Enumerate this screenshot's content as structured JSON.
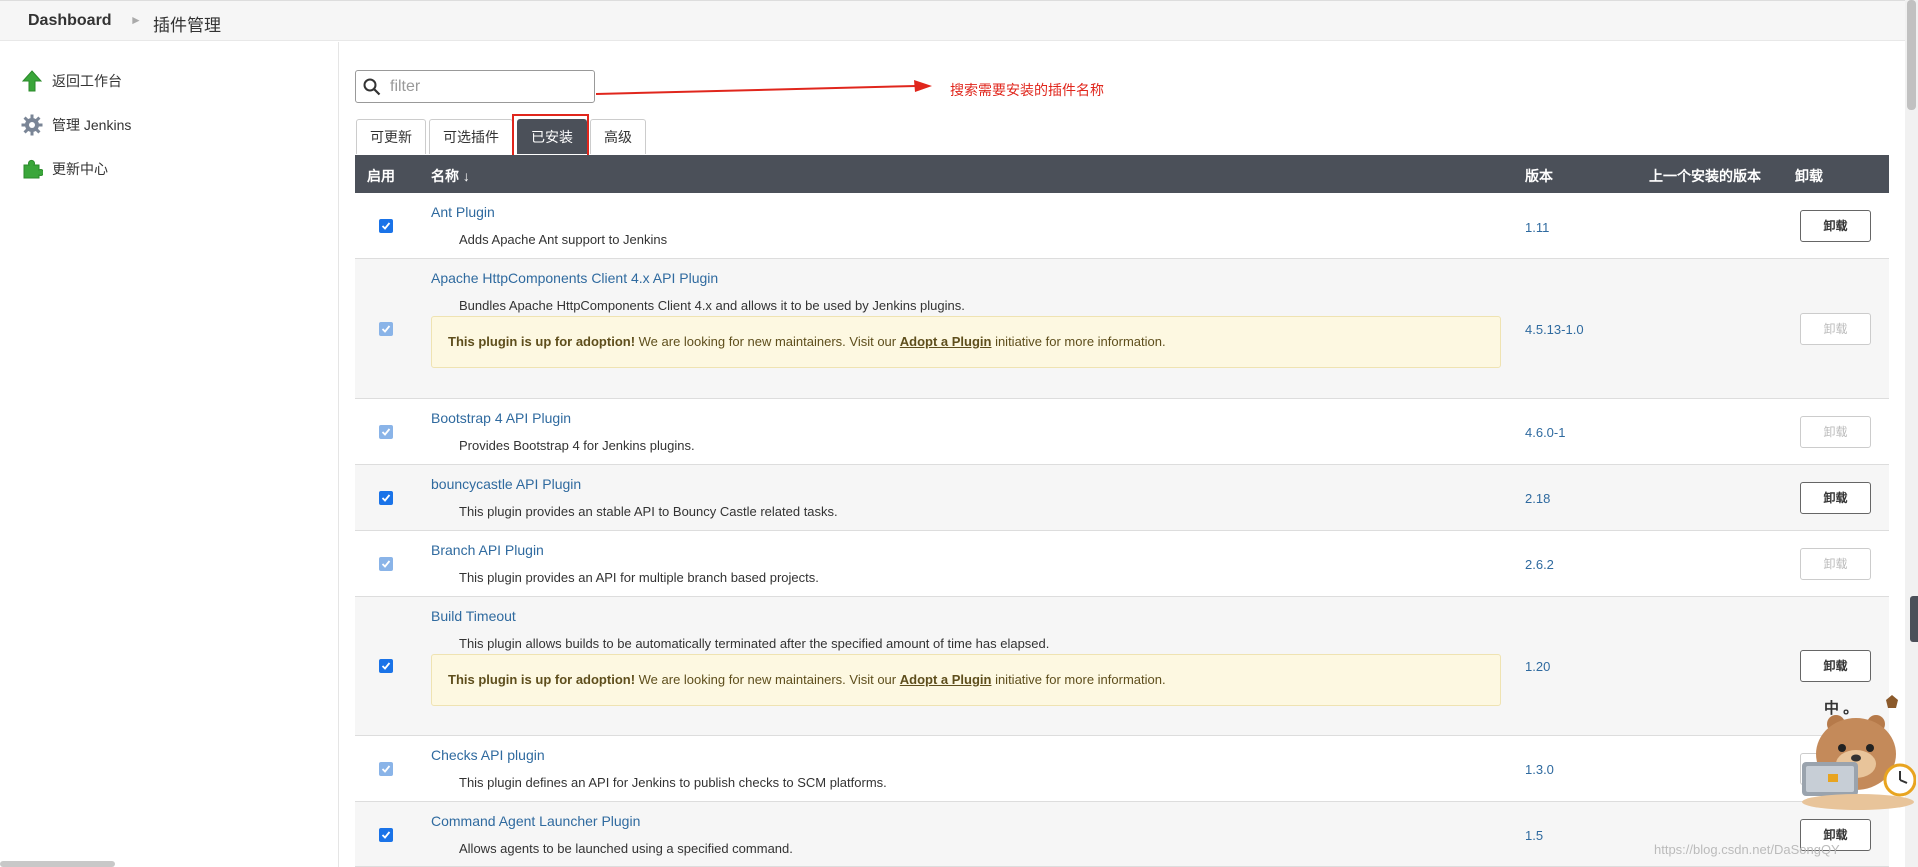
{
  "breadcrumb": {
    "root": "Dashboard",
    "current": "插件管理"
  },
  "sidebar": {
    "items": [
      {
        "label": "返回工作台",
        "icon": "up-arrow-icon"
      },
      {
        "label": "管理 Jenkins",
        "icon": "gear-icon"
      },
      {
        "label": "更新中心",
        "icon": "puzzle-icon"
      }
    ]
  },
  "search": {
    "placeholder": "filter",
    "value": ""
  },
  "annotation": {
    "text": "搜索需要安装的插件名称"
  },
  "tabs": [
    {
      "label": "可更新",
      "active": false
    },
    {
      "label": "可选插件",
      "active": false
    },
    {
      "label": "已安装",
      "active": true
    },
    {
      "label": "高级",
      "active": false
    }
  ],
  "table": {
    "headers": {
      "enabled": "启用",
      "name": "名称 ↓",
      "version": "版本",
      "previous": "上一个安装的版本",
      "uninstall": "卸载"
    },
    "rows": [
      {
        "name": "Ant Plugin",
        "desc": "Adds Apache Ant support to Jenkins",
        "version": "1.11",
        "checked": true,
        "disabled": false,
        "uninstall": "卸载",
        "uninstall_enabled": true
      },
      {
        "name": "Apache HttpComponents Client 4.x API Plugin",
        "desc": "Bundles Apache HttpComponents Client 4.x and allows it to be used by Jenkins plugins.",
        "version": "4.5.13-1.0",
        "checked": true,
        "disabled": true,
        "uninstall": "卸载",
        "uninstall_enabled": false
      },
      {
        "name": "Bootstrap 4 API Plugin",
        "desc": "Provides Bootstrap 4 for Jenkins plugins.",
        "version": "4.6.0-1",
        "checked": true,
        "disabled": true,
        "uninstall": "卸载",
        "uninstall_enabled": false
      },
      {
        "name": "bouncycastle API Plugin",
        "desc": "This plugin provides an stable API to Bouncy Castle related tasks.",
        "version": "2.18",
        "checked": true,
        "disabled": false,
        "uninstall": "卸载",
        "uninstall_enabled": true
      },
      {
        "name": "Branch API Plugin",
        "desc": "This plugin provides an API for multiple branch based projects.",
        "version": "2.6.2",
        "checked": true,
        "disabled": true,
        "uninstall": "卸载",
        "uninstall_enabled": false
      },
      {
        "name": "Build Timeout",
        "desc": "This plugin allows builds to be automatically terminated after the specified amount of time has elapsed.",
        "version": "1.20",
        "checked": true,
        "disabled": false,
        "uninstall": "卸载",
        "uninstall_enabled": true
      },
      {
        "name": "Checks API plugin",
        "desc": "This plugin defines an API for Jenkins to publish checks to SCM platforms.",
        "version": "1.3.0",
        "checked": true,
        "disabled": true,
        "uninstall": "卸载",
        "uninstall_enabled": false
      },
      {
        "name": "Command Agent Launcher Plugin",
        "desc": "Allows agents to be launched using a specified command.",
        "version": "1.5",
        "checked": true,
        "disabled": false,
        "uninstall": "卸载",
        "uninstall_enabled": true
      }
    ],
    "adoption": {
      "bold": "This plugin is up for adoption!",
      "text1": " We are looking for new maintainers. Visit our ",
      "link": "Adopt a Plugin",
      "text2": " initiative for more information."
    }
  },
  "overlay": {
    "ime_text": "中 。",
    "watermark": "https://blog.csdn.net/DaSongQY"
  },
  "colors": {
    "header_bg": "#4b5059",
    "link": "#2f6a9f",
    "annotation": "#e0261c",
    "adopt_bg": "#fdf8e1"
  }
}
